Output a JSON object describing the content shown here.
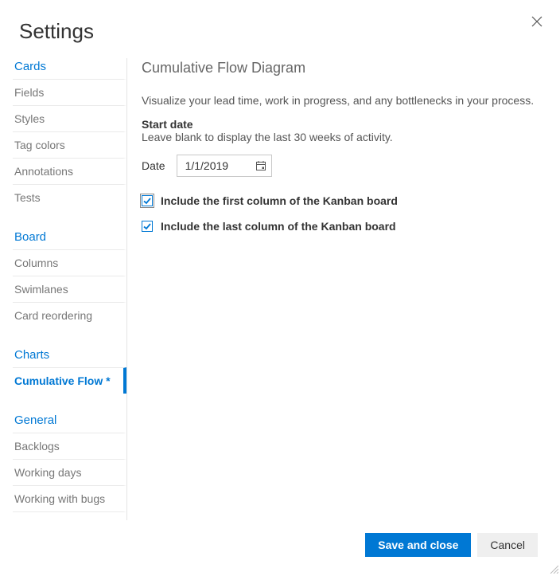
{
  "dialog": {
    "title": "Settings"
  },
  "sidebar": {
    "sections": [
      {
        "header": "Cards",
        "items": [
          {
            "label": "Fields"
          },
          {
            "label": "Styles"
          },
          {
            "label": "Tag colors"
          },
          {
            "label": "Annotations"
          },
          {
            "label": "Tests"
          }
        ]
      },
      {
        "header": "Board",
        "items": [
          {
            "label": "Columns"
          },
          {
            "label": "Swimlanes"
          },
          {
            "label": "Card reordering"
          }
        ]
      },
      {
        "header": "Charts",
        "items": [
          {
            "label": "Cumulative Flow *",
            "selected": true
          }
        ]
      },
      {
        "header": "General",
        "items": [
          {
            "label": "Backlogs"
          },
          {
            "label": "Working days"
          },
          {
            "label": "Working with bugs"
          }
        ]
      }
    ]
  },
  "content": {
    "title": "Cumulative Flow Diagram",
    "description": "Visualize your lead time, work in progress, and any bottlenecks in your process.",
    "startDate": {
      "label": "Start date",
      "help": "Leave blank to display the last 30 weeks of activity.",
      "dateLabel": "Date",
      "dateValue": "1/1/2019"
    },
    "options": {
      "includeFirst": {
        "label": "Include the first column of the Kanban board",
        "checked": true,
        "focused": true
      },
      "includeLast": {
        "label": "Include the last column of the Kanban board",
        "checked": true,
        "focused": false
      }
    }
  },
  "footer": {
    "save": "Save and close",
    "cancel": "Cancel"
  }
}
